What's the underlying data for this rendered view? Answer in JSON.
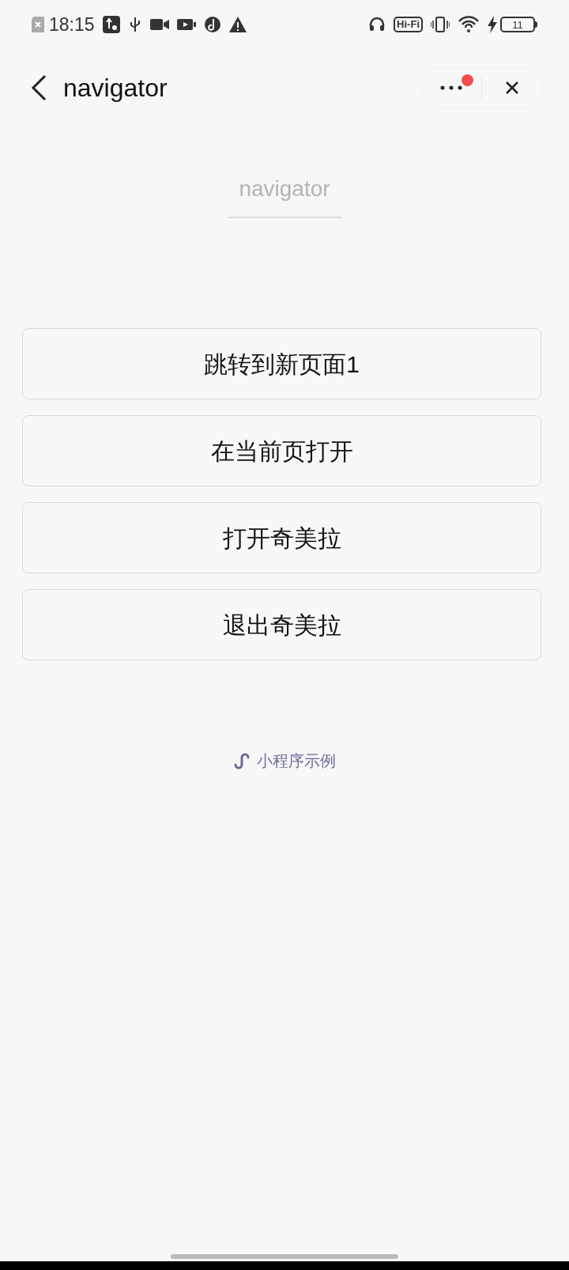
{
  "status_bar": {
    "time": "18:15",
    "hifi": "Hi-Fi",
    "battery": "11"
  },
  "nav_bar": {
    "title": "navigator",
    "has_unread_dot": true
  },
  "header": {
    "title": "navigator"
  },
  "buttons": [
    {
      "label": "跳转到新页面1"
    },
    {
      "label": "在当前页打开"
    },
    {
      "label": "打开奇美拉"
    },
    {
      "label": "退出奇美拉"
    }
  ],
  "footer": {
    "label": "小程序示例"
  }
}
